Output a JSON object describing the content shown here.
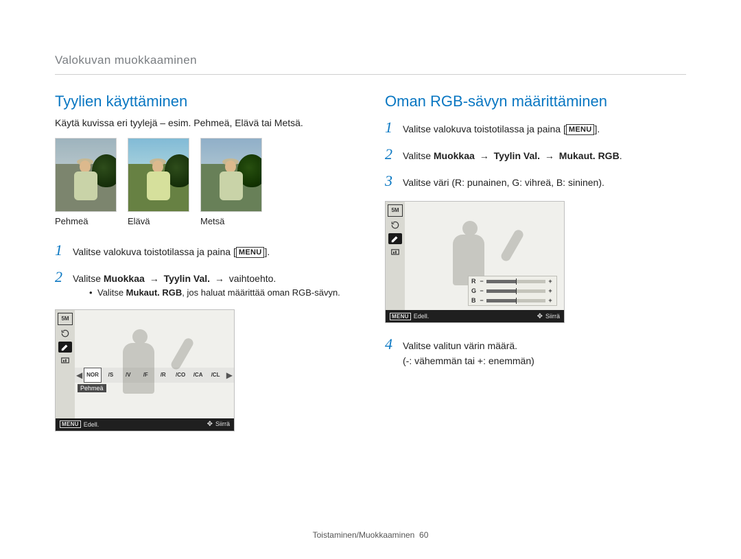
{
  "breadcrumb": "Valokuvan muokkaaminen",
  "left": {
    "title": "Tyylien käyttäminen",
    "intro": "Käytä kuvissa eri tyylejä – esim. Pehmeä, Elävä tai Metsä.",
    "thumbs": [
      "Pehmeä",
      "Elävä",
      "Metsä"
    ],
    "steps": {
      "s1_pre": "Valitse valokuva toistotilassa ja paina [",
      "s1_btn": "MENU",
      "s1_post": "].",
      "s2_pre": "Valitse ",
      "s2_b1": "Muokkaa",
      "s2_arrow": "→",
      "s2_b2": "Tyylin Val.",
      "s2_post": " vaihtoehto.",
      "s2_sub_pre": "Valitse ",
      "s2_sub_b": "Mukaut. RGB",
      "s2_sub_post": ", jos haluat määrittää oman RGB-sävyn."
    },
    "lcd": {
      "badge": "5M",
      "styleLabel": "Pehmeä",
      "footerMenu": "MENU",
      "footerBack": "Edell.",
      "footerMove": "Siirrä",
      "stripIcons": [
        "NOR",
        "/S",
        "/V",
        "/F",
        "/R",
        "/CO",
        "/CA",
        "/CL"
      ]
    }
  },
  "right": {
    "title": "Oman RGB-sävyn määrittäminen",
    "steps": {
      "s1_pre": "Valitse valokuva toistotilassa ja paina [",
      "s1_btn": "MENU",
      "s1_post": "].",
      "s2_pre": "Valitse ",
      "s2_b1": "Muokkaa",
      "s2_arrow": "→",
      "s2_b2": "Tyylin Val.",
      "s2_b3": "Mukaut. RGB",
      "s2_post": ".",
      "s3": "Valitse väri (R: punainen, G: vihreä, B: sininen).",
      "s4": "Valitse valitun värin määrä.",
      "s4_note": "(-: vähemmän tai +: enemmän)"
    },
    "lcd": {
      "badge": "5M",
      "footerMenu": "MENU",
      "footerBack": "Edell.",
      "footerMove": "Siirrä",
      "rgb": [
        "R",
        "G",
        "B"
      ]
    }
  },
  "footer": {
    "section": "Toistaminen/Muokkaaminen",
    "page": "60"
  }
}
